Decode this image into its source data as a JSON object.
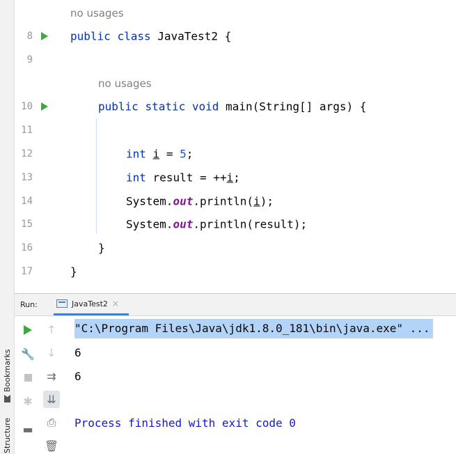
{
  "sidebar": {
    "bookmarks_label": "Bookmarks",
    "structure_label": "Structure"
  },
  "editor": {
    "lines": [
      {
        "hint": "no usages"
      },
      {
        "number": "8",
        "runnable": true,
        "tokens": [
          "public",
          "class",
          "JavaTest2",
          "{"
        ]
      },
      {
        "number": "9"
      },
      {
        "hint": "no usages"
      },
      {
        "number": "10",
        "runnable": true,
        "tokens": [
          "public",
          "static",
          "void",
          "main",
          "(",
          "String",
          "[]",
          "args",
          ")",
          "{"
        ]
      },
      {
        "number": "11"
      },
      {
        "number": "12",
        "tokens": [
          "int",
          "i",
          "=",
          "5",
          ";"
        ]
      },
      {
        "number": "13",
        "tokens": [
          "int",
          "result",
          "=",
          "++",
          "i",
          ";"
        ]
      },
      {
        "number": "14",
        "tokens": [
          "System",
          ".",
          "out",
          ".println(",
          "i",
          ");"
        ]
      },
      {
        "number": "15",
        "tokens": [
          "System",
          ".",
          "out",
          ".println(result);"
        ]
      },
      {
        "number": "16",
        "tokens": [
          "}"
        ]
      },
      {
        "number": "17",
        "tokens": [
          "}"
        ]
      }
    ]
  },
  "run_panel": {
    "label": "Run:",
    "tab_title": "JavaTest2",
    "tab_close": "×",
    "console": {
      "command": "\"C:\\Program Files\\Java\\jdk1.8.0_181\\bin\\java.exe\" ...",
      "output_1": "6",
      "output_2": "6",
      "exit": "Process finished with exit code 0"
    },
    "toolbar_icons": {
      "rerun": "play-icon",
      "settings": "wrench-icon",
      "stop": "stop-icon",
      "debug": "debug-icon",
      "layout": "layout-icon",
      "up": "arrow-up-icon",
      "down": "arrow-down-icon",
      "wrap": "soft-wrap-icon",
      "scroll_end": "scroll-to-end-icon",
      "print": "print-icon",
      "clear": "trash-icon"
    },
    "glyphs": {
      "up": "↑",
      "down": "↓",
      "wrap": "⇉",
      "scroll_end": "⇊",
      "wrench": "🔧",
      "debug": "✱",
      "layout": "▬",
      "print": "⎙",
      "trash": "🗑"
    }
  },
  "colors": {
    "keyword": "#0033b3",
    "number": "#1750eb",
    "static_field": "#871094",
    "console_exit": "#1717c8",
    "selection": "#b3d3f7",
    "run_green": "#3ea83e"
  }
}
